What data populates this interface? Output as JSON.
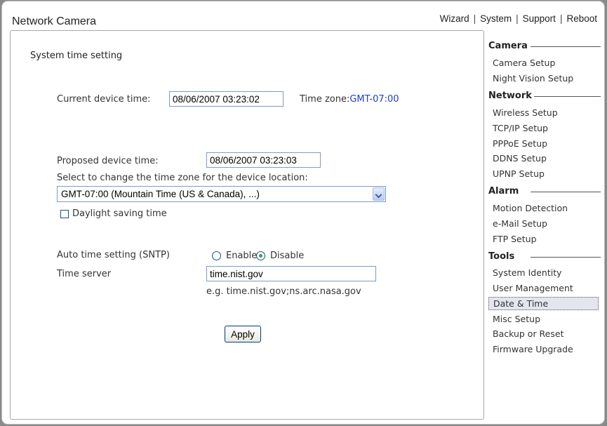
{
  "app": {
    "title": "Network Camera"
  },
  "topnav": {
    "wizard": "Wizard",
    "system": "System",
    "support": "Support",
    "reboot": "Reboot",
    "separator": "|"
  },
  "main": {
    "title": "System time setting",
    "current_time_label": "Current device time:",
    "current_time_value": "08/06/2007 03:23:02",
    "timezone_label": "Time zone:",
    "timezone_value": "GMT-07:00",
    "proposed_time_label": "Proposed device time:",
    "proposed_time_value": "08/06/2007 03:23:03",
    "select_tz_label": "Select to change the time zone for the device location:",
    "tz_selected": "GMT-07:00 (Mountain Time (US & Canada), ...)",
    "daylight_label": "Daylight saving time",
    "daylight_checked": false,
    "sntp_label": "Auto time setting (SNTP)",
    "enable_label": "Enable",
    "disable_label": "Disable",
    "sntp_selected": "Disable",
    "time_server_label": "Time server",
    "time_server_value": "time.nist.gov",
    "example_text": "e.g. time.nist.gov;ns.arc.nasa.gov",
    "apply_label": "Apply"
  },
  "sidebar": {
    "camera": {
      "title": "Camera",
      "items": [
        "Camera Setup",
        "Night Vision Setup"
      ]
    },
    "network": {
      "title": "Network",
      "items": [
        "Wireless Setup",
        "TCP/IP Setup",
        "PPPoE Setup",
        "DDNS Setup",
        "UPNP Setup"
      ]
    },
    "alarm": {
      "title": "Alarm",
      "items": [
        "Motion Detection",
        "e-Mail Setup",
        "FTP Setup"
      ]
    },
    "tools": {
      "title": "Tools",
      "items": [
        "System Identity",
        "User Management",
        "Date & Time",
        "Misc Setup",
        "Backup or Reset",
        "Firmware Upgrade"
      ]
    },
    "active_item": "Date & Time"
  }
}
